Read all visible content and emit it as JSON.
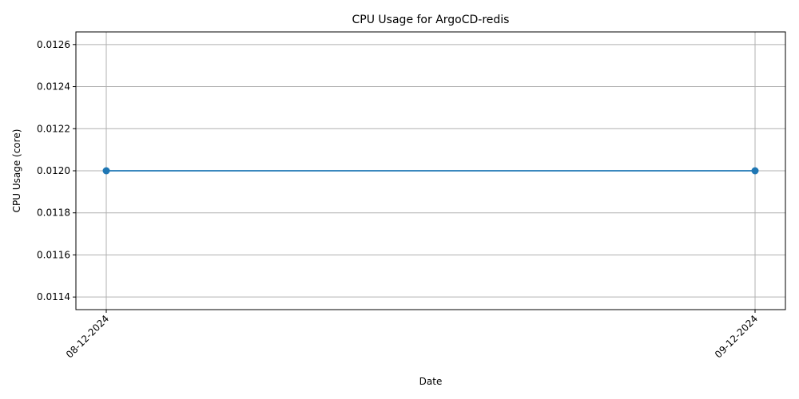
{
  "chart_data": {
    "type": "line",
    "title": "CPU Usage for ArgoCD-redis",
    "xlabel": "Date",
    "ylabel": "CPU Usage (core)",
    "categories": [
      "08-12-2024",
      "09-12-2024"
    ],
    "series": [
      {
        "values": [
          0.012,
          0.012
        ],
        "color": "#1f77b4",
        "marker": "circle"
      }
    ],
    "ylim": [
      0.01134,
      0.01266
    ],
    "yticks": [
      "0.0114",
      "0.0116",
      "0.0118",
      "0.0120",
      "0.0122",
      "0.0124",
      "0.0126"
    ],
    "grid": true
  }
}
